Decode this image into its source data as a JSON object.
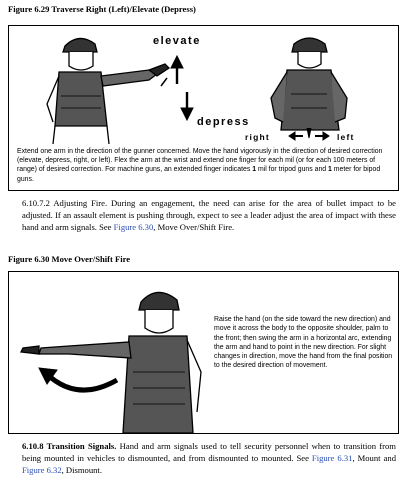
{
  "figure_629": {
    "title": "Figure 6.29  Traverse Right (Left)/Elevate (Depress)",
    "label_elevate": "elevate",
    "label_depress": "depress",
    "label_right": "right",
    "label_left": "left",
    "caption_a": "Extend one arm in the direction of the gunner concerned. Move the hand vigorously in the direction of desired correction (elevate, depress, right, or left). Flex the arm at the wrist and extend one finger for each mil (or for each 100 meters of range) of desired correction. For machine guns, an extended finger indicates ",
    "caption_bold1": "1",
    "caption_b": " mil for tripod guns and ",
    "caption_bold2": "1",
    "caption_c": " meter for bipod guns."
  },
  "paragraph_6_10_7_2": {
    "text_before": "6.10.7.2  Adjusting Fire. During an engagement, the need can arise for the area of bullet impact to be adjusted. If an assault element is pushing through, expect to see a leader adjust the area of impact with these hand and arm signals. See ",
    "link": "Figure 6.30",
    "text_after": ", Move Over/Shift Fire."
  },
  "figure_630": {
    "title": "Figure 6.30  Move Over/Shift Fire",
    "caption": "Raise the hand (on the side toward the new direction) and move it across the body to the opposite shoulder, palm to the front; then swing the arm in a horizontal arc, extending the arm and hand to point in the new direction. For slight changes in direction, move the hand from the final position to the desired direction of movement."
  },
  "paragraph_6_10_8": {
    "heading": "6.10.8  Transition Signals.",
    "text": " Hand and arm signals used to tell security personnel when to transition from being mounted in vehicles to dismounted, and from dismounted to mounted. See ",
    "link1": "Figure 6.31",
    "text_mid": ", Mount and ",
    "link2": "Figure 6.32",
    "text_end": ", Dismount."
  }
}
